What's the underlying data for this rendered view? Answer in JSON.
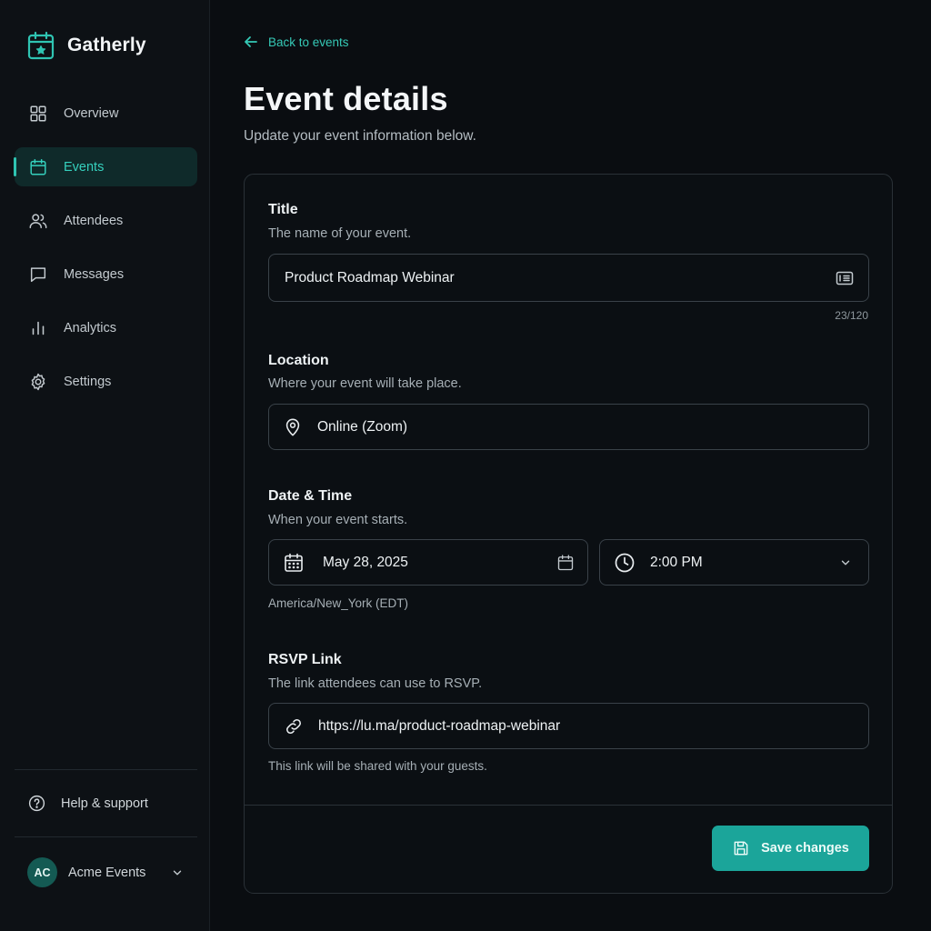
{
  "brand": {
    "name": "Gatherly",
    "icon": "calendar-star-icon",
    "accent": "#2fc4b2"
  },
  "sidebar": {
    "items": [
      {
        "label": "Overview",
        "icon": "grid-icon"
      },
      {
        "label": "Events",
        "icon": "calendar-icon",
        "active": true
      },
      {
        "label": "Attendees",
        "icon": "users-icon"
      },
      {
        "label": "Messages",
        "icon": "message-icon"
      },
      {
        "label": "Analytics",
        "icon": "bar-chart-icon"
      },
      {
        "label": "Settings",
        "icon": "gear-icon"
      }
    ],
    "help_label": "Help & support",
    "account": {
      "initials": "AC",
      "name": "Acme Events"
    }
  },
  "header": {
    "back_label": "Back to events",
    "title": "Event details",
    "subtitle": "Update your event information below."
  },
  "form": {
    "title": {
      "label": "Title",
      "description": "The name of your event.",
      "value": "Product Roadmap Webinar",
      "counter": "23/120"
    },
    "location": {
      "label": "Location",
      "description": "Where your event will take place.",
      "value": "Online (Zoom)"
    },
    "datetime": {
      "label": "Date & Time",
      "description": "When your event starts.",
      "date_value": "May 28, 2025",
      "time_value": "2:00 PM",
      "timezone": "America/New_York (EDT)"
    },
    "rsvp": {
      "label": "RSVP Link",
      "description": "The link attendees can use to RSVP.",
      "value": "https://lu.ma/product-roadmap-webinar",
      "helper": "This link will be shared with your guests."
    },
    "save_label": "Save changes"
  }
}
